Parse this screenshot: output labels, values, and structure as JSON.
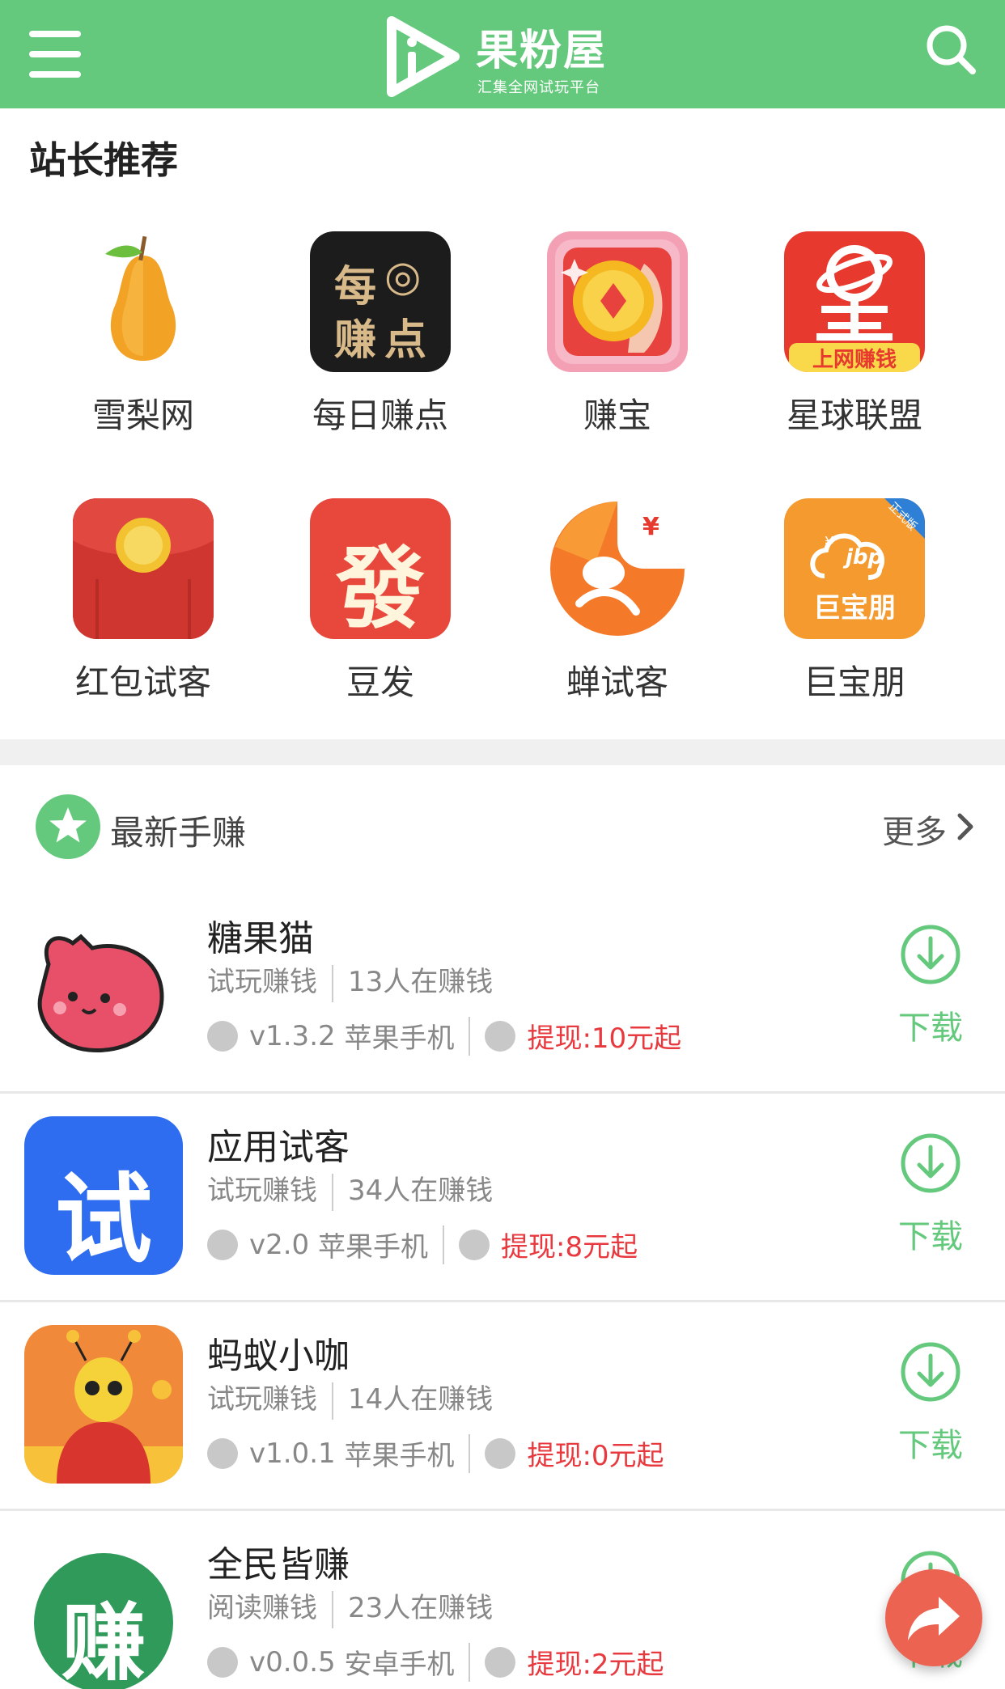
{
  "header": {
    "logo_title": "果粉屋",
    "logo_subtitle": "汇集全网试玩平台",
    "brand_color": "#64c97c"
  },
  "recommend": {
    "title": "站长推荐",
    "items": [
      {
        "label": "雪梨网",
        "icon": "pear-icon"
      },
      {
        "label": "每日赚点",
        "icon": "meiri-zhuandian-icon"
      },
      {
        "label": "赚宝",
        "icon": "gold-coin-icon"
      },
      {
        "label": "星球联盟",
        "icon": "planet-icon"
      },
      {
        "label": "红包试客",
        "icon": "red-envelope-icon"
      },
      {
        "label": "豆发",
        "icon": "fa-character-icon"
      },
      {
        "label": "蝉试客",
        "icon": "cicada-icon"
      },
      {
        "label": "巨宝朋",
        "icon": "jubaopeng-icon"
      }
    ],
    "icon_texts": {
      "meiri": [
        "每",
        "◎",
        "赚",
        "点"
      ],
      "xingqiu_banner": "上网赚钱",
      "fa": "發",
      "jbp_brand": "巨宝朋",
      "jbp_mark": "jbp",
      "jbp_ribbon": "正式版",
      "yuan_symbol": "¥"
    }
  },
  "latest": {
    "title": "最新手赚",
    "more_label": "更多",
    "apps": [
      {
        "name": "糖果猫",
        "category": "试玩赚钱",
        "users": "13人在赚钱",
        "version": "v1.3.2",
        "platform": "苹果手机",
        "withdraw": "提现:10元起",
        "download": "下载"
      },
      {
        "name": "应用试客",
        "category": "试玩赚钱",
        "users": "34人在赚钱",
        "version": "v2.0",
        "platform": "苹果手机",
        "withdraw": "提现:8元起",
        "download": "下载"
      },
      {
        "name": "蚂蚁小咖",
        "category": "试玩赚钱",
        "users": "14人在赚钱",
        "version": "v1.0.1",
        "platform": "苹果手机",
        "withdraw": "提现:0元起",
        "download": "下载"
      },
      {
        "name": "全民皆赚",
        "category": "阅读赚钱",
        "users": "23人在赚钱",
        "version": "v0.0.5",
        "platform": "安卓手机",
        "withdraw": "提现:2元起",
        "download": "下载"
      }
    ],
    "thumb_texts": {
      "shike": "试",
      "zhuan": "赚"
    }
  }
}
